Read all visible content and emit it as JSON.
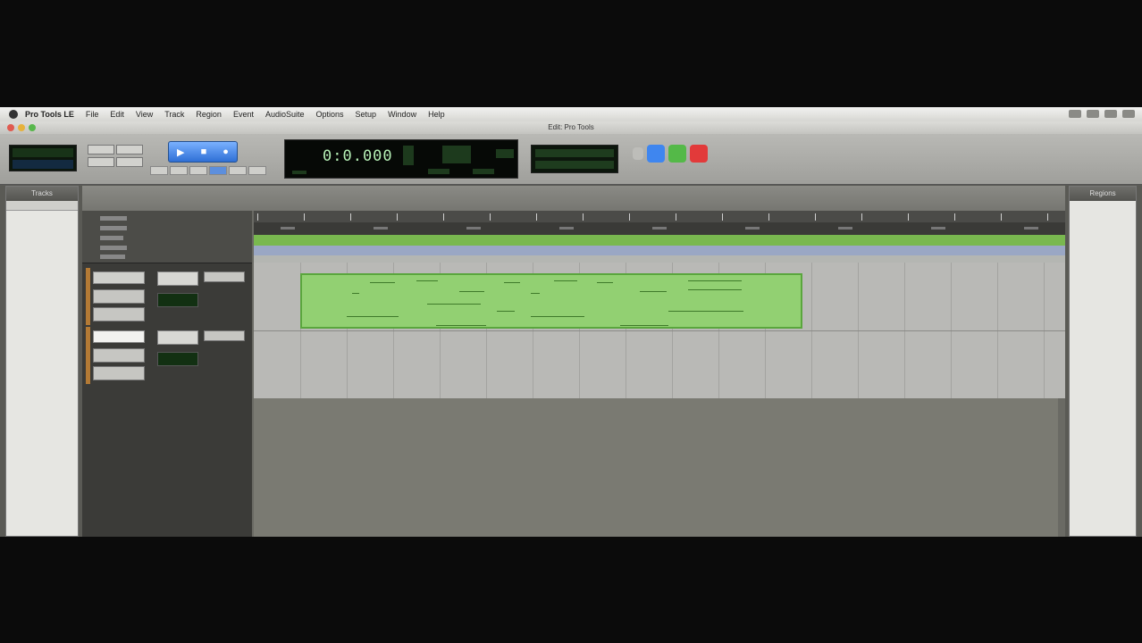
{
  "menubar": {
    "items": [
      "Pro Tools LE",
      "File",
      "Edit",
      "View",
      "Track",
      "Region",
      "Event",
      "AudioSuite",
      "Options",
      "Setup",
      "Window",
      "Help"
    ]
  },
  "window": {
    "title": "Edit: Pro Tools"
  },
  "toolbar": {
    "transport_buttons": [
      "play-icon",
      "stop-icon",
      "record-icon"
    ],
    "main_counter": "0:0.000",
    "accent_color": "#3f86ef"
  },
  "colors": {
    "clip": "#92d072",
    "clip_border": "#5aa63d",
    "lcd_text": "#7fe07f"
  },
  "tracks": [
    {
      "color": "#b37a35"
    },
    {
      "color": "#b37a35"
    }
  ],
  "panels": {
    "left_header": "Tracks",
    "right_header": "Regions"
  }
}
